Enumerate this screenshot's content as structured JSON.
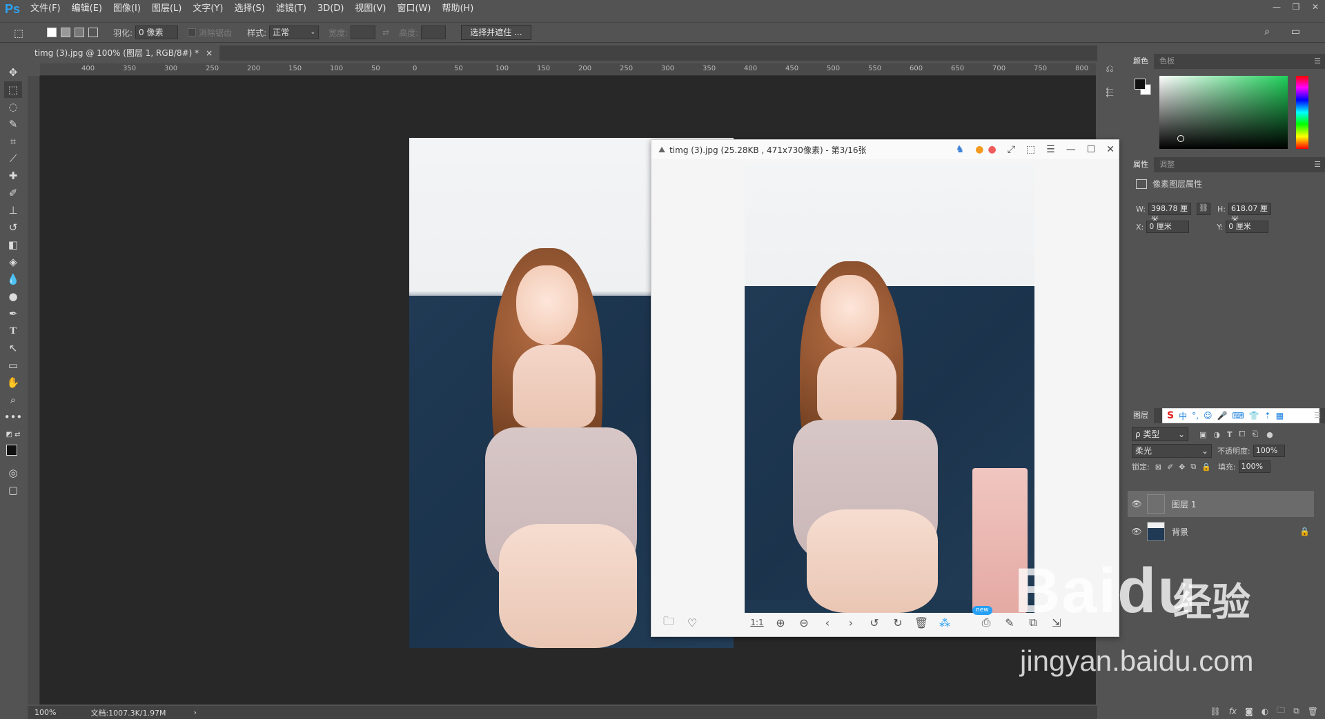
{
  "menubar": {
    "logo": "Ps",
    "items": [
      "文件(F)",
      "编辑(E)",
      "图像(I)",
      "图层(L)",
      "文字(Y)",
      "选择(S)",
      "滤镜(T)",
      "3D(D)",
      "视图(V)",
      "窗口(W)",
      "帮助(H)"
    ]
  },
  "options": {
    "feather_label": "羽化:",
    "feather_value": "0 像素",
    "antialias_label": "消除锯齿",
    "style_label": "样式:",
    "style_value": "正常",
    "width_label": "宽度:",
    "height_label": "高度:",
    "select_mask_button": "选择并遮住 ..."
  },
  "document": {
    "tab_title": "timg (3).jpg @ 100% (图层 1, RGB/8#) *",
    "tab_close": "×",
    "ruler_ticks": [
      "400",
      "350",
      "300",
      "250",
      "200",
      "150",
      "100",
      "50",
      "0",
      "50",
      "100",
      "150",
      "200",
      "250",
      "300",
      "350",
      "400",
      "450",
      "500",
      "550",
      "600",
      "650",
      "700",
      "750",
      "800"
    ]
  },
  "viewer": {
    "title": "timg (3).jpg (25.28KB , 471x730像素) - 第3/16张",
    "ratio_button": "1:1",
    "new_badge": "new"
  },
  "color_panel": {
    "tabs": [
      "颜色",
      "色板"
    ],
    "fg_color": "#111111",
    "bg_color": "#ffffff"
  },
  "properties_panel": {
    "tabs": [
      "属性",
      "调整"
    ],
    "heading": "像素图层属性",
    "w_label": "W:",
    "w_value": "398.78 厘米",
    "h_label": "H:",
    "h_value": "618.07 厘米",
    "x_label": "X:",
    "x_value": "0 厘米",
    "y_label": "Y:",
    "y_value": "0 厘米"
  },
  "layers_panel": {
    "tab": "图层",
    "filter_label": "ρ 类型",
    "blend_mode": "柔光",
    "opacity_label": "不透明度:",
    "opacity_value": "100%",
    "lock_label": "锁定:",
    "fill_label": "填充:",
    "fill_value": "100%",
    "layers": [
      {
        "name": "图层 1",
        "selected": true
      },
      {
        "name": "背景",
        "locked": true
      }
    ],
    "ime": [
      "中",
      "°,",
      "☺",
      "🎤",
      "⌨",
      "👕",
      "⇡",
      "▦"
    ]
  },
  "status": {
    "zoom": "100%",
    "doc_size": "文档:1007.3K/1.97M"
  },
  "watermark": {
    "brand": "Baidu",
    "brand_cn": "经验",
    "url": "jingyan.baidu.com"
  }
}
